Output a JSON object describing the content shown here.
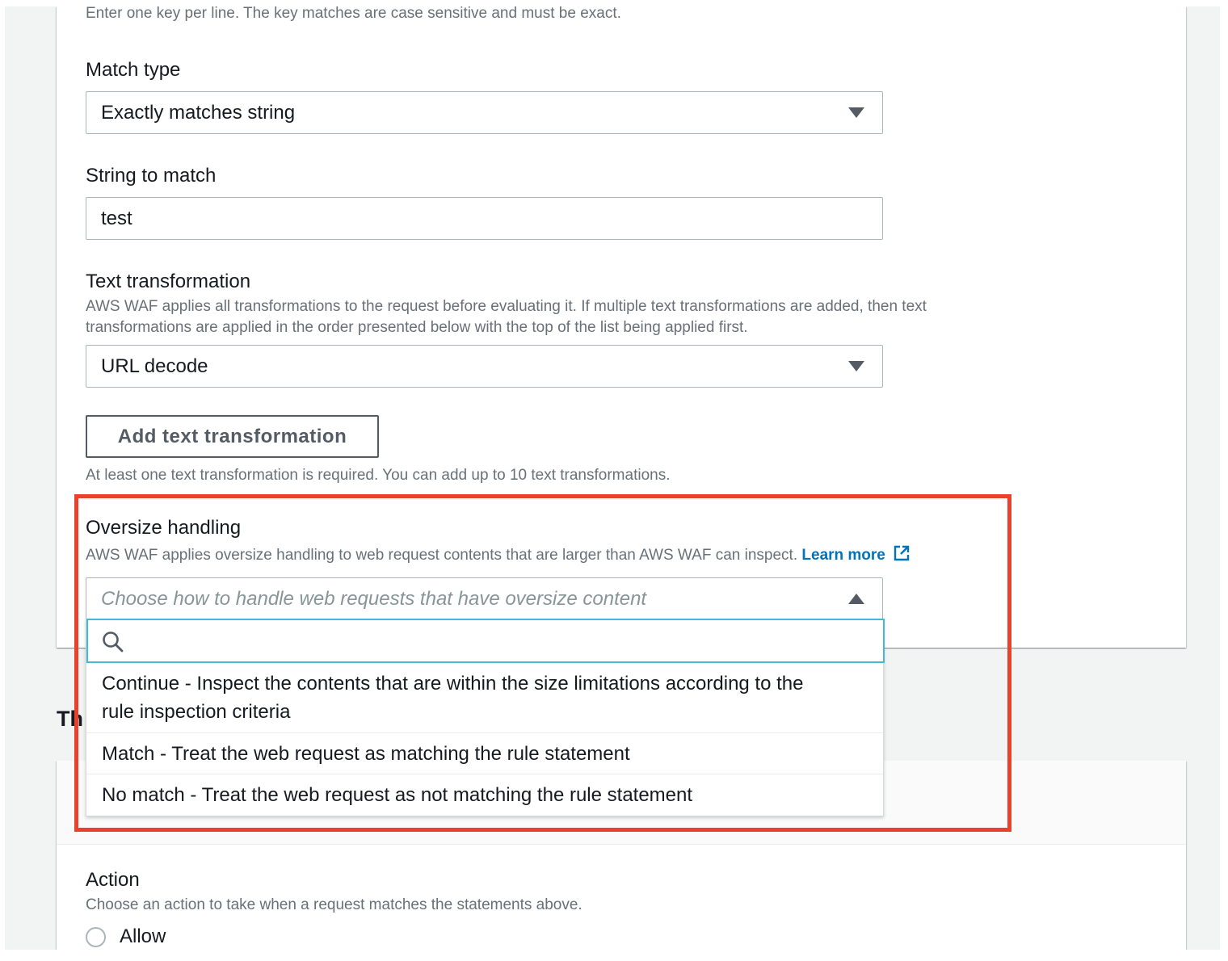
{
  "top_hint": "Enter one key per line. The key matches are case sensitive and must be exact.",
  "match_type": {
    "label": "Match type",
    "selected": "Exactly matches string",
    "caret_icon": "caret-down-icon"
  },
  "string_to_match": {
    "label": "String to match",
    "value": "test"
  },
  "text_transformation": {
    "label": "Text transformation",
    "description_line1": "AWS WAF applies all transformations to the request before evaluating it. If multiple text transformations are added, then text",
    "description_line2": "transformations are applied in the order presented below with the top of the list being applied first.",
    "selected": "URL decode",
    "add_button_label": "Add text transformation",
    "constraint_hint": "At least one text transformation is required. You can add up to 10 text transformations."
  },
  "oversize_handling": {
    "label": "Oversize handling",
    "description": "AWS WAF applies oversize handling to web request contents that are larger than AWS WAF can inspect.",
    "learn_more": "Learn more",
    "placeholder": "Choose how to handle web requests that have oversize content",
    "options": [
      {
        "line1": "Continue - Inspect the contents that are within the size limitations according to the",
        "line2": "rule inspection criteria"
      },
      {
        "line1": "Match - Treat the web request as matching the rule statement"
      },
      {
        "line1": "No match - Treat the web request as not matching the rule statement"
      }
    ],
    "highlight_color": "#e8412c"
  },
  "partial_heading": "Th",
  "action": {
    "label": "Action",
    "description": "Choose an action to take when a request matches the statements above.",
    "radio_allow_label": "Allow"
  },
  "colors": {
    "link": "#0073bb",
    "focus": "#44b9d6",
    "text": "#16191f",
    "hint": "#687078"
  }
}
